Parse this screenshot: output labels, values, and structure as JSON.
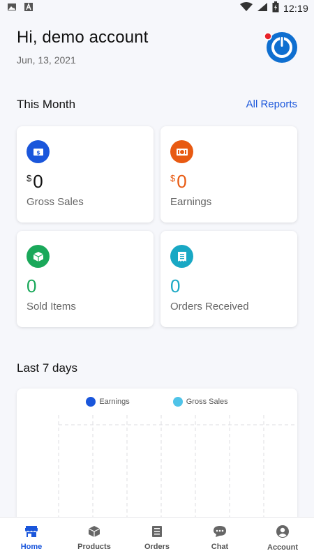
{
  "status_bar": {
    "time": "12:19"
  },
  "header": {
    "greeting": "Hi, demo account",
    "date": "Jun, 13, 2021"
  },
  "this_month": {
    "title": "This Month",
    "all_reports": "All Reports",
    "cards": [
      {
        "currency": "$",
        "value": "0",
        "label": "Gross Sales",
        "color": "#1a56db",
        "icon": "dollar-bill-icon"
      },
      {
        "currency": "$",
        "value": "0",
        "label": "Earnings",
        "color": "#e85a12",
        "icon": "money-icon"
      },
      {
        "currency": "",
        "value": "0",
        "label": "Sold Items",
        "color": "#1aa85a",
        "icon": "box-icon"
      },
      {
        "currency": "",
        "value": "0",
        "label": "Orders Received",
        "color": "#19a8c4",
        "icon": "receipt-icon"
      }
    ]
  },
  "last7": {
    "title": "Last 7 days",
    "legend": [
      {
        "label": "Earnings",
        "color": "#1a56db"
      },
      {
        "label": "Gross Sales",
        "color": "#4fc3e8"
      }
    ]
  },
  "nav": {
    "items": [
      {
        "label": "Home",
        "icon": "store-icon"
      },
      {
        "label": "Products",
        "icon": "box-icon"
      },
      {
        "label": "Orders",
        "icon": "receipt-icon"
      },
      {
        "label": "Chat",
        "icon": "chat-icon"
      },
      {
        "label": "Account",
        "icon": "account-icon"
      }
    ],
    "active": "Home"
  },
  "colors": {
    "accent": "#1a56db",
    "background": "#f6f7fb"
  }
}
